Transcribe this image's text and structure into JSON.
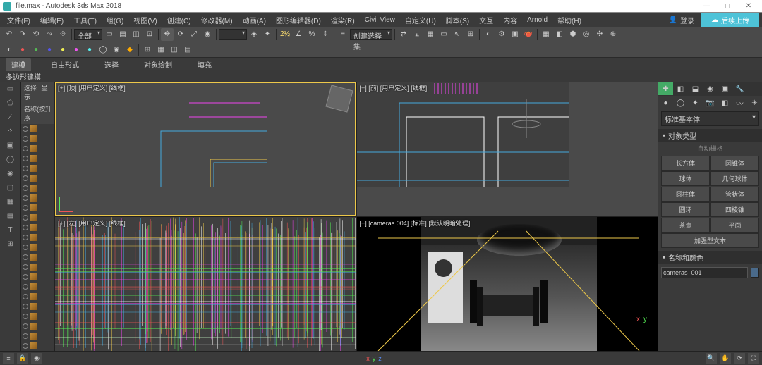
{
  "title": "file.max - Autodesk 3ds Max 2018",
  "menus": [
    "文件(F)",
    "编辑(E)",
    "工具(T)",
    "组(G)",
    "视图(V)",
    "创建(C)",
    "修改器(M)",
    "动画(A)",
    "图形编辑器(D)",
    "渲染(R)",
    "Civil View",
    "自定义(U)",
    "脚本(S)",
    "交互",
    "内容",
    "Arnold",
    "帮助(H)"
  ],
  "login_label": "登录",
  "upload_label": "后续上传",
  "workspace_dd": "全部",
  "ribbon_tabs": [
    "建模",
    "自由形式",
    "选择",
    "对象绘制",
    "填充"
  ],
  "ribbon_active": 0,
  "subtab": "多边形建模",
  "scene_header": "名称(按升序",
  "viewport_labels": {
    "tl": "[+] [顶] [用户定义] [线框]",
    "tr": "[+] [前] [用户定义] [线框]",
    "bl": "[+] [左] [用户定义] [线框]",
    "br_a": "[+] [cameras 004] [标准]",
    "br_b": "[默认明暗处理]"
  },
  "viewport_axes": [
    "选择",
    "显示"
  ],
  "right_panel": {
    "category": "标准基本体",
    "rollup_objtype": "对象类型",
    "autogrid": "自动栅格",
    "buttons": [
      "长方体",
      "圆锥体",
      "球体",
      "几何球体",
      "圆柱体",
      "管状体",
      "圆环",
      "四棱锥",
      "茶壶",
      "平面",
      "加强型文本",
      ""
    ],
    "rollup_name": "名称和颜色",
    "obj_name": "cameras_001"
  },
  "status_xyz": [
    "x",
    "y",
    "z"
  ]
}
